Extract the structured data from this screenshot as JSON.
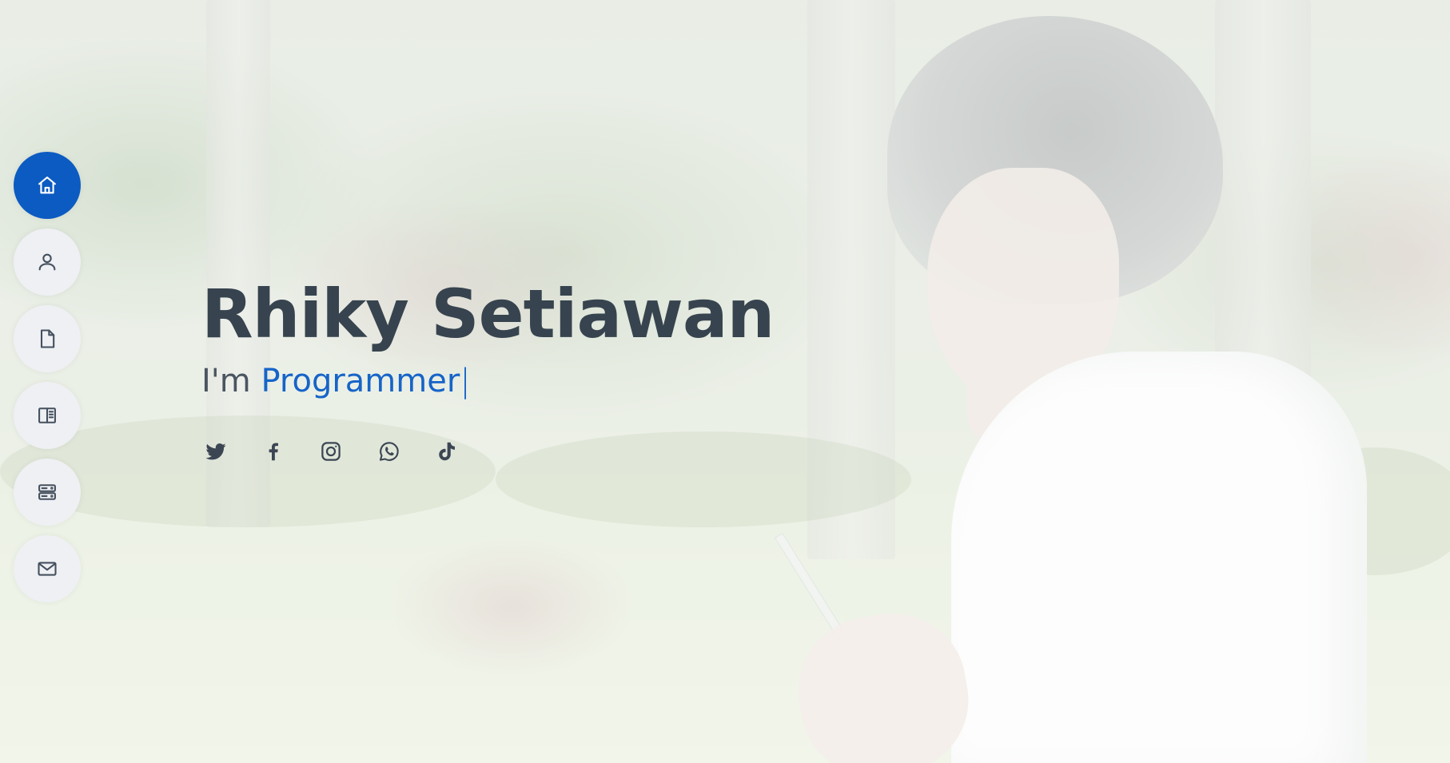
{
  "hero": {
    "name": "Rhiky Setiawan",
    "tagline_prefix": "I'm",
    "typed_text": "Programmer",
    "cursor": "|"
  },
  "side_nav": {
    "items": [
      {
        "id": "home",
        "icon": "home-icon",
        "active": true
      },
      {
        "id": "about",
        "icon": "person-icon",
        "active": false
      },
      {
        "id": "resume",
        "icon": "file-icon",
        "active": false
      },
      {
        "id": "portfolio",
        "icon": "book-half-icon",
        "active": false
      },
      {
        "id": "services",
        "icon": "server-icon",
        "active": false
      },
      {
        "id": "contact",
        "icon": "envelope-icon",
        "active": false
      }
    ]
  },
  "social": [
    {
      "id": "twitter",
      "icon": "twitter-icon"
    },
    {
      "id": "facebook",
      "icon": "facebook-icon"
    },
    {
      "id": "instagram",
      "icon": "instagram-icon"
    },
    {
      "id": "whatsapp",
      "icon": "whatsapp-icon"
    },
    {
      "id": "tiktok",
      "icon": "tiktok-icon"
    }
  ],
  "colors": {
    "accent": "#0c5bc2",
    "heading": "#37444f",
    "nav_bg": "#eef0f3",
    "icon": "#45505f"
  }
}
